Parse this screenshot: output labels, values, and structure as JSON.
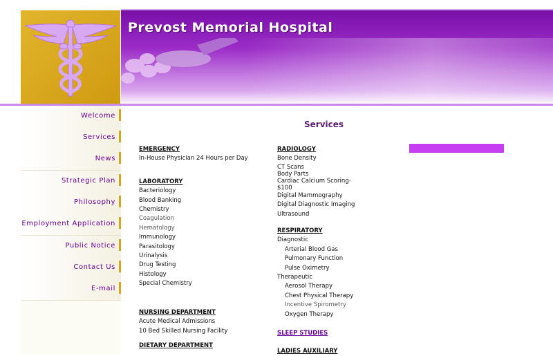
{
  "site": {
    "title": "Prevost Memorial Hospital"
  },
  "sidebar": {
    "items": [
      {
        "label": "Welcome"
      },
      {
        "label": "Services"
      },
      {
        "label": "News"
      },
      {
        "label": "Strategic Plan"
      },
      {
        "label": "Philosophy"
      },
      {
        "label": "Employment Application"
      },
      {
        "label": "Public Notice"
      },
      {
        "label": "Contact Us"
      },
      {
        "label": "E-mail"
      }
    ]
  },
  "main": {
    "title": "Services",
    "col1": {
      "emergency": {
        "head": "EMERGENCY",
        "items": [
          "In-House Physician 24 Hours per Day"
        ]
      },
      "laboratory": {
        "head": "LABORATORY",
        "items": [
          "Bacteriology",
          "Blood Banking",
          "Chemistry",
          "Coagulation",
          "Hematology",
          "Immunology",
          "Parasitology",
          "Urinalysis",
          "Drug Testing",
          "Histology",
          "Special Chemistry"
        ]
      },
      "nursing": {
        "head": "NURSING DEPARTMENT",
        "items": [
          "Acute Medical Admissions",
          "10 Bed Skilled Nursing Facility"
        ]
      },
      "dietary": {
        "head": "DIETARY DEPARTMENT"
      }
    },
    "col2": {
      "radiology": {
        "head": "RADIOLOGY",
        "items": [
          "Bone Density",
          "CT Scans",
          "Body Parts",
          "Cardiac Calcium Scoring-",
          "$100",
          "Digital Mammography",
          "Digital Diagnostic Imaging",
          "Ultrasound"
        ]
      },
      "respiratory": {
        "head": "RESPIRATORY",
        "diagnostic": "Diagnostic",
        "diag_items": [
          "Arterial Blood Gas",
          "Pulmonary Function",
          "Pulse Oximetry"
        ],
        "therapeutic": "Therapeutic",
        "ther_items": [
          "Aerosol Therapy",
          "Chest Physical Therapy",
          "Incentive Spirometry",
          "Oxygen Therapy"
        ]
      },
      "sleep": {
        "head": "SLEEP STUDIES"
      },
      "ladies": {
        "head": "LADIES AUXILIARY"
      }
    }
  },
  "colors": {
    "brand_purple": "#7a0fa8",
    "gold": "#d9a520",
    "accent": "#c63df2"
  },
  "icons": {
    "logo": "caduceus-icon"
  }
}
